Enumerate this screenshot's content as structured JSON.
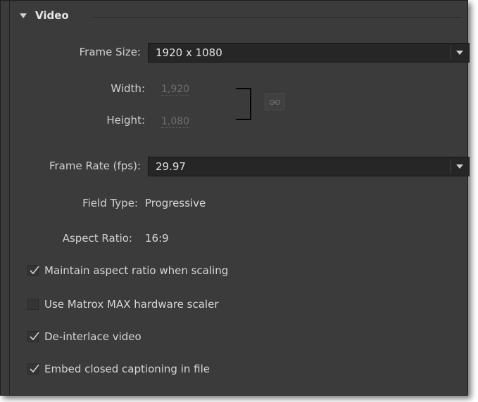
{
  "section": {
    "title": "Video"
  },
  "frame_size": {
    "label": "Frame Size:",
    "value": "1920 x 1080"
  },
  "dimensions": {
    "width_label": "Width:",
    "width_value": "1,920",
    "height_label": "Height:",
    "height_value": "1,080"
  },
  "frame_rate": {
    "label": "Frame Rate (fps):",
    "value": "29.97"
  },
  "field_type": {
    "label": "Field Type:",
    "value": "Progressive"
  },
  "aspect_ratio": {
    "label": "Aspect Ratio:",
    "value": "16:9"
  },
  "options": [
    {
      "label": "Maintain aspect ratio when scaling",
      "checked": true
    },
    {
      "label": "Use Matrox MAX hardware scaler",
      "checked": false
    },
    {
      "label": "De-interlace video",
      "checked": true
    },
    {
      "label": "Embed closed captioning in file",
      "checked": true
    }
  ],
  "icons": {
    "section_toggle": "triangle-down-icon",
    "dropdown_arrow": "chevron-down-icon",
    "link": "chain-link-icon",
    "check": "checkmark-icon"
  },
  "colors": {
    "panel_bg": "#3b3b3b",
    "field_bg": "#262626",
    "text": "#d0d0d0",
    "disabled_text": "#6e6e6e"
  }
}
